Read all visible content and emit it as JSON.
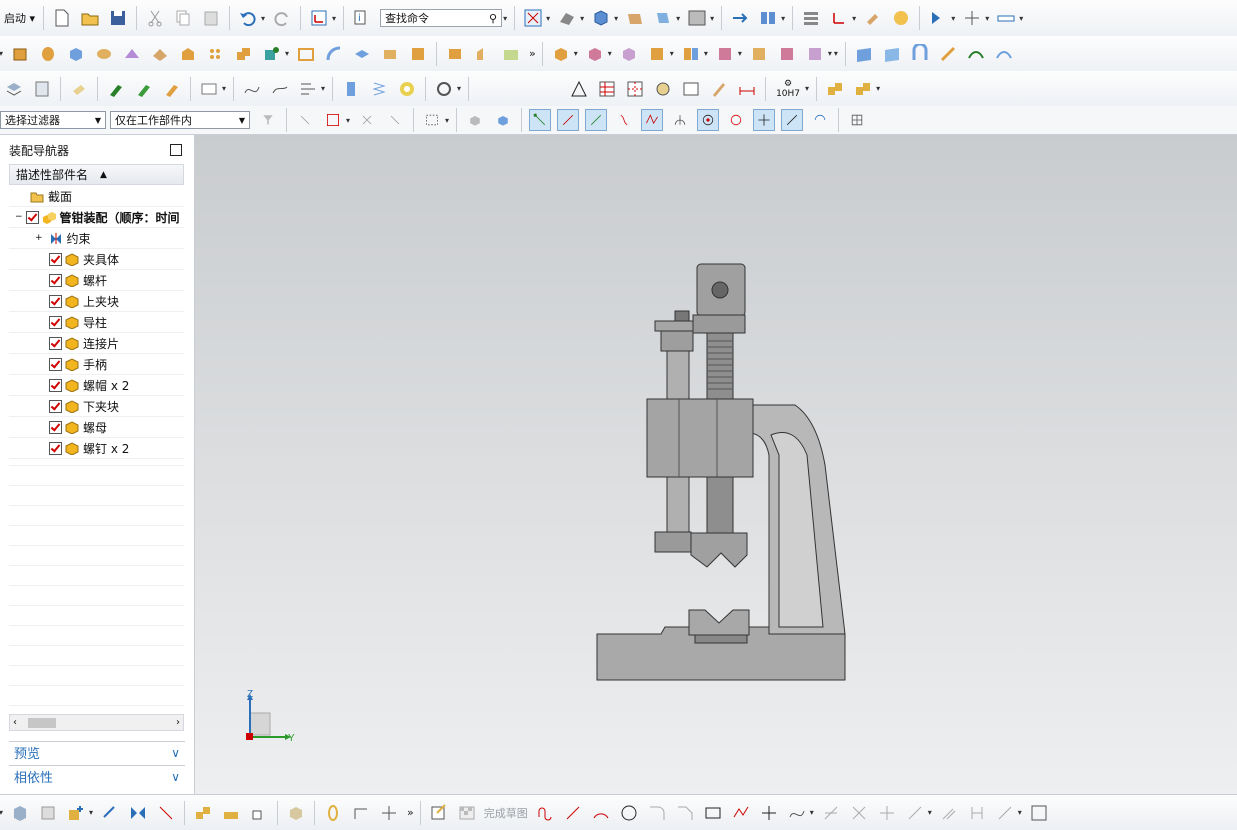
{
  "toolbar": {
    "start_label": "启动",
    "find_command_placeholder": "查找命令",
    "selection_filter": "选择过滤器",
    "scope": "仅在工作部件内",
    "fit_label": "10H7"
  },
  "navigator": {
    "title": "装配导航器",
    "column_header": "描述性部件名",
    "items": [
      {
        "label": "截面",
        "type": "folder"
      },
      {
        "label": "管钳装配（顺序：时间",
        "type": "assembly"
      },
      {
        "label": "约束",
        "type": "constraint"
      },
      {
        "label": "夹具体",
        "type": "part"
      },
      {
        "label": "螺杆",
        "type": "part"
      },
      {
        "label": "上夹块",
        "type": "part"
      },
      {
        "label": "导柱",
        "type": "part"
      },
      {
        "label": "连接片",
        "type": "part"
      },
      {
        "label": "手柄",
        "type": "part"
      },
      {
        "label": "螺帽 x 2",
        "type": "part"
      },
      {
        "label": "下夹块",
        "type": "part"
      },
      {
        "label": "螺母",
        "type": "part"
      },
      {
        "label": "螺钉 x 2",
        "type": "part"
      }
    ],
    "panels": {
      "preview": "预览",
      "dependencies": "相依性"
    }
  },
  "triad": {
    "z": "Z",
    "y": "Y"
  },
  "bottom": {
    "finish_sketch": "完成草图"
  },
  "colors": {
    "accent": "#2a6fb8",
    "check": "#d00000",
    "part": "#f2b520",
    "model": "#9a9a9a"
  }
}
